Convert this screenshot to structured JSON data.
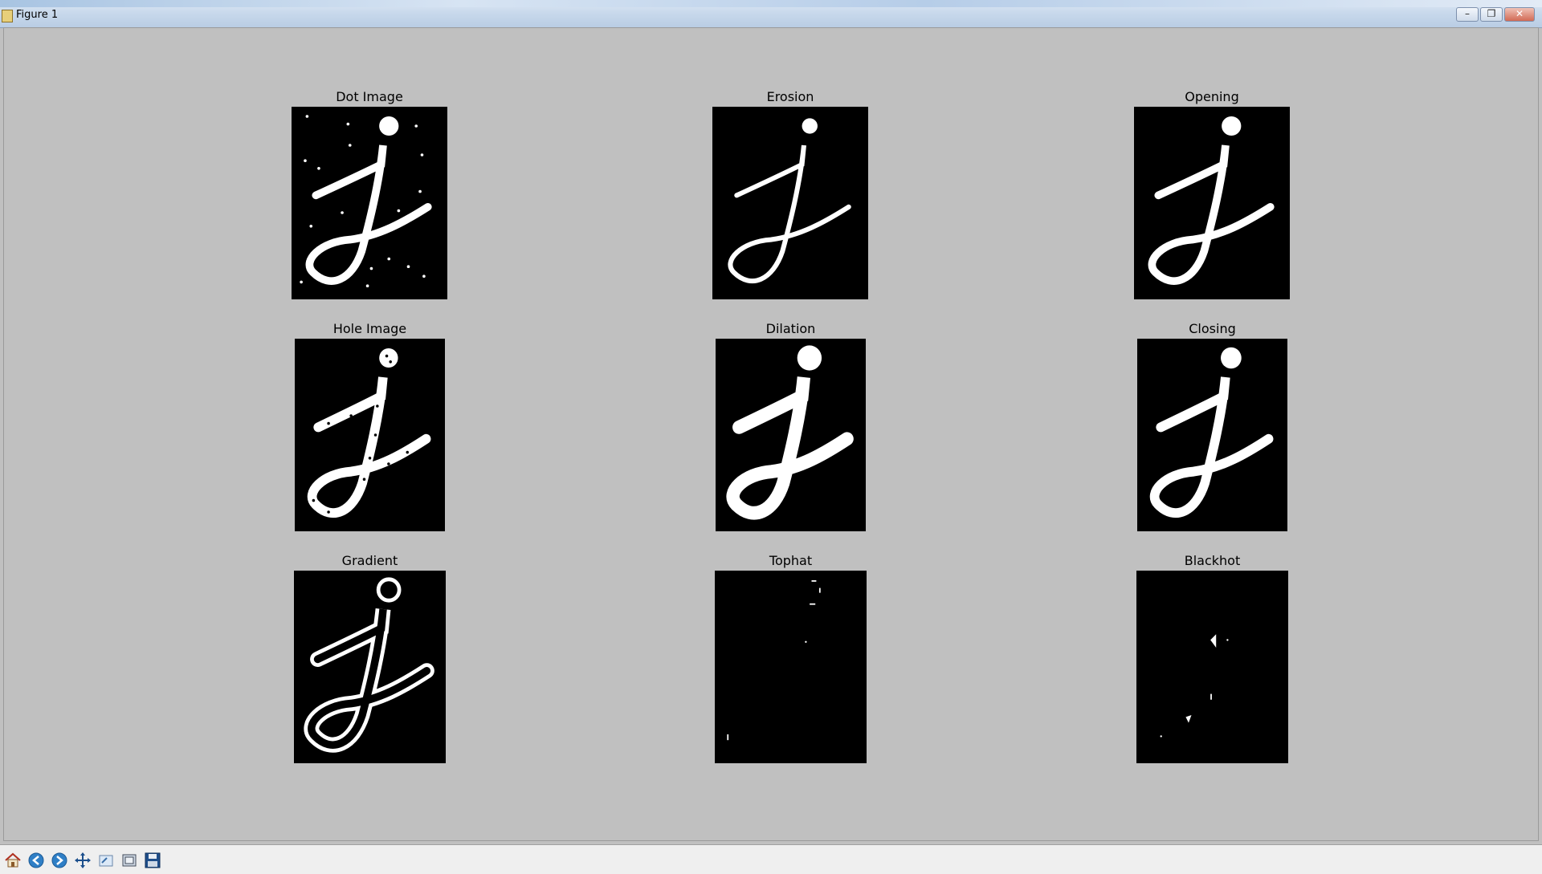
{
  "window": {
    "title": "Figure 1"
  },
  "panels": [
    {
      "title": "Dot Image"
    },
    {
      "title": "Erosion"
    },
    {
      "title": "Opening"
    },
    {
      "title": "Hole Image"
    },
    {
      "title": "Dilation"
    },
    {
      "title": "Closing"
    },
    {
      "title": "Gradient"
    },
    {
      "title": "Tophat"
    },
    {
      "title": "Blackhot"
    }
  ],
  "toolbar": {
    "buttons": [
      {
        "icon": "home-icon"
      },
      {
        "icon": "back-arrow-icon"
      },
      {
        "icon": "forward-arrow-icon"
      },
      {
        "icon": "pan-icon"
      },
      {
        "icon": "zoom-icon"
      },
      {
        "icon": "configure-subplots-icon"
      },
      {
        "icon": "save-icon"
      }
    ]
  }
}
